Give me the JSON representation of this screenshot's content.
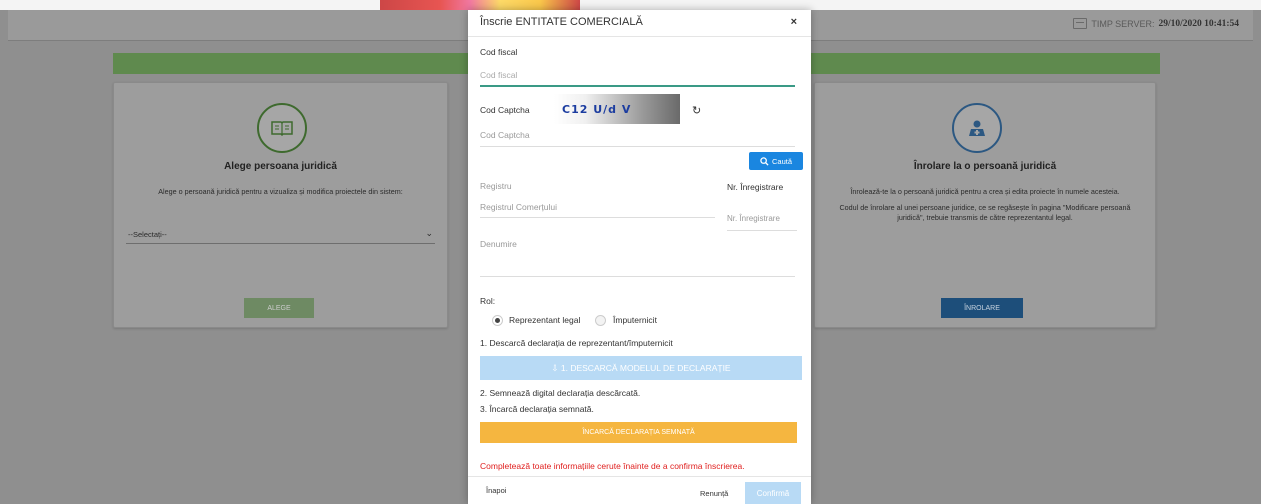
{
  "server": {
    "label": "TIMP SERVER:",
    "time": "29/10/2020 10:41:54"
  },
  "left_card": {
    "title": "Alege persoana juridică",
    "text": "Alege o persoană juridică pentru a vizualiza și modifica proiectele din sistem:",
    "select_value": "--Selectați--",
    "button": "ALEGE"
  },
  "right_card": {
    "title": "Înrolare la o persoană juridică",
    "text1": "Înrolează-te la o persoană juridică pentru a crea și edita proiecte în numele acesteia.",
    "text2": "Codul de înrolare al unei persoane juridice, ce se regăsește în pagina \"Modificare persoană juridică\", trebuie transmis de către reprezentantul legal.",
    "button": "ÎNROLARE"
  },
  "modal": {
    "title": "Înscrie ENTITATE COMERCIALĂ",
    "close": "×",
    "cod_fiscal_label": "Cod fiscal",
    "cod_fiscal_placeholder": "Cod fiscal",
    "captcha_label": "Cod Captcha",
    "captcha_text": "C12 U/d V",
    "captcha_placeholder": "Cod Captcha",
    "cauta_button": "Caută",
    "registru_label": "Registru",
    "registru_value": "Registrul Comerțului",
    "nr_label": "Nr. Înregistrare",
    "nr_placeholder": "Nr. Înregistrare",
    "denumire_placeholder": "Denumire",
    "rol_label": "Rol:",
    "rol_options": [
      "Reprezentant legal",
      "Împuternicit"
    ],
    "step1": "1. Descarcă declarația de reprezentant/împuternicit",
    "download_button": "1. DESCARCĂ MODELUL DE DECLARAȚIE",
    "step2": "2. Semnează digital declarația descărcată.",
    "step3": "3. Încarcă declarația semnată.",
    "upload_button": "ÎNCARCĂ DECLARAȚIA SEMNATĂ",
    "warning": "Completează toate informațiile cerute înainte de a confirma înscrierea.",
    "back_button": "Înapoi",
    "cancel_button": "Renunță",
    "confirm_button": "Confirmă"
  },
  "colors": {
    "primary": "#1a86e0",
    "disabled_primary": "#b8daf5",
    "warning_button": "#f5b640",
    "error_text": "#e0201f"
  }
}
